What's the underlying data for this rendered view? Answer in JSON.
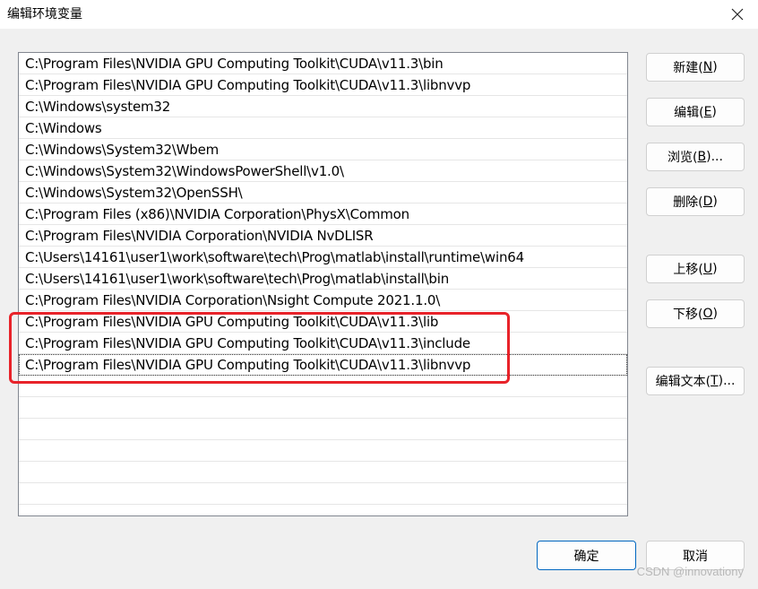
{
  "window": {
    "title": "编辑环境变量"
  },
  "list": {
    "items": [
      "C:\\Program Files\\NVIDIA GPU Computing Toolkit\\CUDA\\v11.3\\bin",
      "C:\\Program Files\\NVIDIA GPU Computing Toolkit\\CUDA\\v11.3\\libnvvp",
      "C:\\Windows\\system32",
      "C:\\Windows",
      "C:\\Windows\\System32\\Wbem",
      "C:\\Windows\\System32\\WindowsPowerShell\\v1.0\\",
      "C:\\Windows\\System32\\OpenSSH\\",
      "C:\\Program Files (x86)\\NVIDIA Corporation\\PhysX\\Common",
      "C:\\Program Files\\NVIDIA Corporation\\NVIDIA NvDLISR",
      "C:\\Users\\14161\\user1\\work\\software\\tech\\Prog\\matlab\\install\\runtime\\win64",
      "C:\\Users\\14161\\user1\\work\\software\\tech\\Prog\\matlab\\install\\bin",
      "C:\\Program Files\\NVIDIA Corporation\\Nsight Compute 2021.1.0\\",
      "C:\\Program Files\\NVIDIA GPU Computing Toolkit\\CUDA\\v11.3\\lib",
      "C:\\Program Files\\NVIDIA GPU Computing Toolkit\\CUDA\\v11.3\\include",
      "C:\\Program Files\\NVIDIA GPU Computing Toolkit\\CUDA\\v11.3\\libnvvp"
    ],
    "selected_index": 14,
    "empty_rows": 6
  },
  "buttons": {
    "new": {
      "label": "新建(",
      "key": "N",
      "end": ")"
    },
    "edit": {
      "label": "编辑(",
      "key": "E",
      "end": ")"
    },
    "browse": {
      "label": "浏览(",
      "key": "B",
      "end": ")..."
    },
    "delete": {
      "label": "删除(",
      "key": "D",
      "end": ")"
    },
    "up": {
      "label": "上移(",
      "key": "U",
      "end": ")"
    },
    "down": {
      "label": "下移(",
      "key": "O",
      "end": ")"
    },
    "edit_text": {
      "label": "编辑文本(",
      "key": "T",
      "end": ")..."
    },
    "ok": "确定",
    "cancel": "取消"
  },
  "watermark": "CSDN @innovationy",
  "colors": {
    "highlight": "#e8232a",
    "ok_border": "#0067c0"
  }
}
